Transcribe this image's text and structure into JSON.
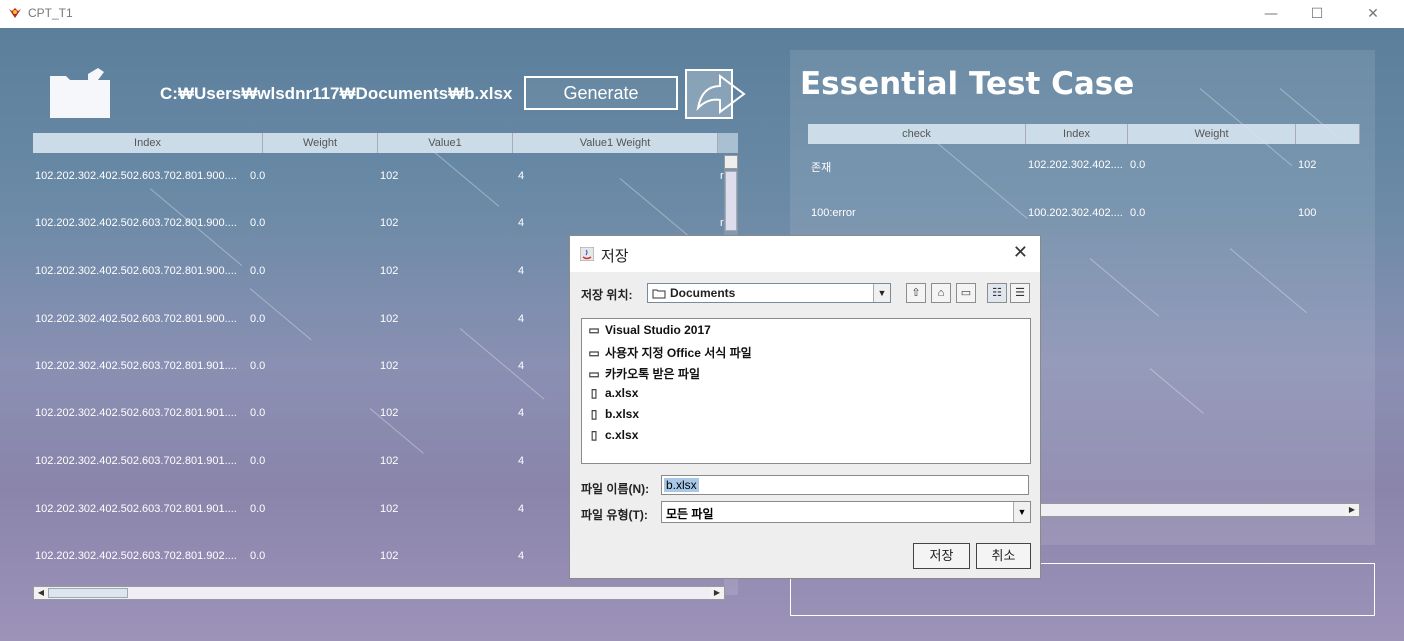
{
  "window": {
    "title": "CPT_T1",
    "minimize": "—",
    "maximize": "☐",
    "close": "✕"
  },
  "left": {
    "path": "C:₩Users₩wlsdnr117₩Documents₩b.xlsx",
    "generate_label": "Generate",
    "columns": [
      "Index",
      "Weight",
      "Value1",
      "Value1 Weight"
    ],
    "rows": [
      [
        "102.202.302.402.502.603.702.801.900....",
        "0.0",
        "102",
        "4",
        "r"
      ],
      [
        "102.202.302.402.502.603.702.801.900....",
        "0.0",
        "102",
        "4",
        "r"
      ],
      [
        "102.202.302.402.502.603.702.801.900....",
        "0.0",
        "102",
        "4",
        ""
      ],
      [
        "102.202.302.402.502.603.702.801.900....",
        "0.0",
        "102",
        "4",
        ""
      ],
      [
        "102.202.302.402.502.603.702.801.901....",
        "0.0",
        "102",
        "4",
        ""
      ],
      [
        "102.202.302.402.502.603.702.801.901....",
        "0.0",
        "102",
        "4",
        ""
      ],
      [
        "102.202.302.402.502.603.702.801.901....",
        "0.0",
        "102",
        "4",
        ""
      ],
      [
        "102.202.302.402.502.603.702.801.901....",
        "0.0",
        "102",
        "4",
        ""
      ],
      [
        "102.202.302.402.502.603.702.801.902....",
        "0.0",
        "102",
        "4",
        ""
      ]
    ]
  },
  "right": {
    "title": "Essential Test Case",
    "columns": [
      "check",
      "Index",
      "Weight",
      ""
    ],
    "rows": [
      [
        "존재",
        "102.202.302.402....",
        "0.0",
        "102"
      ],
      [
        "100:error",
        "100.202.302.402....",
        "0.0",
        "100"
      ]
    ]
  },
  "dialog": {
    "title": "저장",
    "lookin_label": "저장 위치:",
    "lookin_value": "Documents",
    "items": [
      {
        "name": "Visual Studio 2017",
        "icon": "folder-icon"
      },
      {
        "name": "사용자 지정 Office 서식 파일",
        "icon": "folder-icon"
      },
      {
        "name": "카카오톡 받은 파일",
        "icon": "folder-icon"
      },
      {
        "name": "a.xlsx",
        "icon": "file-icon"
      },
      {
        "name": "b.xlsx",
        "icon": "file-icon"
      },
      {
        "name": "c.xlsx",
        "icon": "file-icon"
      }
    ],
    "filename_label": "파일 이름(N):",
    "filename_value": "b.xlsx",
    "filetype_label": "파일 유형(T):",
    "filetype_value": "모든 파일",
    "save_label": "저장",
    "cancel_label": "취소"
  }
}
